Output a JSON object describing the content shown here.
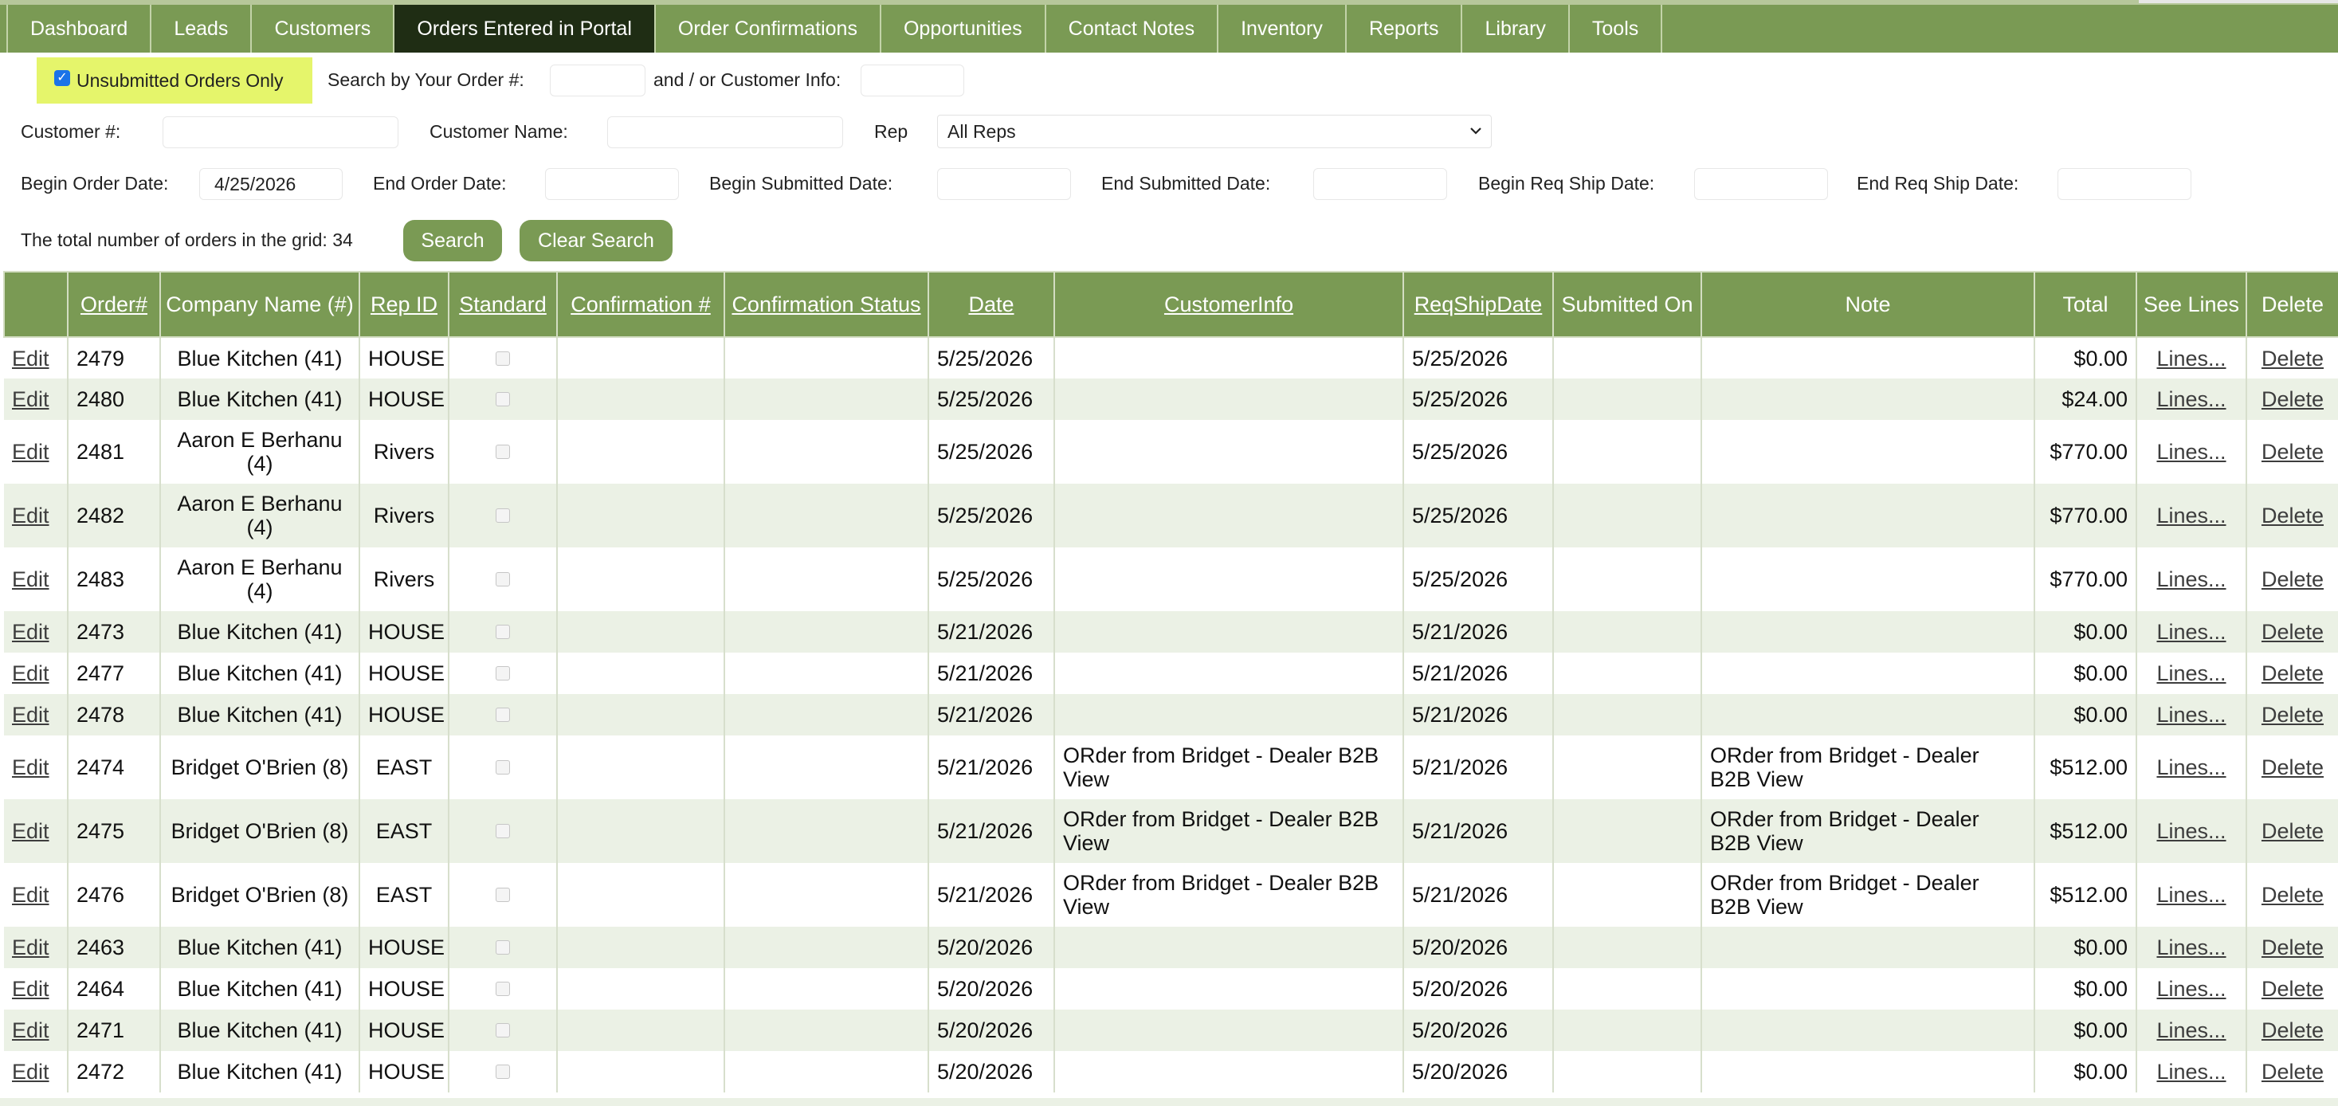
{
  "nav": {
    "tabs": [
      {
        "label": "Dashboard",
        "active": false
      },
      {
        "label": "Leads",
        "active": false
      },
      {
        "label": "Customers",
        "active": false
      },
      {
        "label": "Orders Entered in Portal",
        "active": true
      },
      {
        "label": "Order Confirmations",
        "active": false
      },
      {
        "label": "Opportunities",
        "active": false
      },
      {
        "label": "Contact Notes",
        "active": false
      },
      {
        "label": "Inventory",
        "active": false
      },
      {
        "label": "Reports",
        "active": false
      },
      {
        "label": "Library",
        "active": false
      },
      {
        "label": "Tools",
        "active": false
      }
    ]
  },
  "filters": {
    "unsubmitted_label": "Unsubmitted Orders Only",
    "unsubmitted_checked": true,
    "search_order_label": "Search by Your Order #:",
    "and_or_label": "and / or Customer Info:",
    "customer_num_label": "Customer #:",
    "customer_name_label": "Customer Name:",
    "rep_label": "Rep",
    "rep_value": "All Reps",
    "begin_order_date_label": "Begin Order Date:",
    "begin_order_date_value": "4/25/2026",
    "end_order_date_label": "End Order Date:",
    "begin_submitted_label": "Begin Submitted Date:",
    "end_submitted_label": "End Submitted Date:",
    "begin_req_ship_label": "Begin Req Ship Date:",
    "end_req_ship_label": "End Req Ship Date:",
    "total_label": "The total number of orders in the grid: 34",
    "search_button": "Search",
    "clear_button": "Clear Search"
  },
  "grid": {
    "headers": {
      "edit": "",
      "order": "Order#",
      "company": "Company Name (#)",
      "rep": "Rep ID",
      "standard": "Standard",
      "conf_num": "Confirmation #",
      "conf_status": "Confirmation Status",
      "date": "Date",
      "customer_info": "CustomerInfo",
      "req_ship": "ReqShipDate",
      "submitted": "Submitted On",
      "note": "Note",
      "total": "Total",
      "see_lines": "See Lines",
      "delete": "Delete"
    },
    "edit_text": "Edit",
    "lines_text": "Lines...",
    "delete_text": "Delete",
    "rows": [
      {
        "order": "2479",
        "company": "Blue Kitchen (41)",
        "rep": "HOUSE",
        "date": "5/25/2026",
        "customer_info": "",
        "req_ship": "5/25/2026",
        "submitted": "",
        "note": "",
        "total": "$0.00"
      },
      {
        "order": "2480",
        "company": "Blue Kitchen (41)",
        "rep": "HOUSE",
        "date": "5/25/2026",
        "customer_info": "",
        "req_ship": "5/25/2026",
        "submitted": "",
        "note": "",
        "total": "$24.00"
      },
      {
        "order": "2481",
        "company": "Aaron E Berhanu (4)",
        "rep": "Rivers",
        "date": "5/25/2026",
        "customer_info": "",
        "req_ship": "5/25/2026",
        "submitted": "",
        "note": "",
        "total": "$770.00"
      },
      {
        "order": "2482",
        "company": "Aaron E Berhanu (4)",
        "rep": "Rivers",
        "date": "5/25/2026",
        "customer_info": "",
        "req_ship": "5/25/2026",
        "submitted": "",
        "note": "",
        "total": "$770.00"
      },
      {
        "order": "2483",
        "company": "Aaron E Berhanu (4)",
        "rep": "Rivers",
        "date": "5/25/2026",
        "customer_info": "",
        "req_ship": "5/25/2026",
        "submitted": "",
        "note": "",
        "total": "$770.00"
      },
      {
        "order": "2473",
        "company": "Blue Kitchen (41)",
        "rep": "HOUSE",
        "date": "5/21/2026",
        "customer_info": "",
        "req_ship": "5/21/2026",
        "submitted": "",
        "note": "",
        "total": "$0.00"
      },
      {
        "order": "2477",
        "company": "Blue Kitchen (41)",
        "rep": "HOUSE",
        "date": "5/21/2026",
        "customer_info": "",
        "req_ship": "5/21/2026",
        "submitted": "",
        "note": "",
        "total": "$0.00"
      },
      {
        "order": "2478",
        "company": "Blue Kitchen (41)",
        "rep": "HOUSE",
        "date": "5/21/2026",
        "customer_info": "",
        "req_ship": "5/21/2026",
        "submitted": "",
        "note": "",
        "total": "$0.00"
      },
      {
        "order": "2474",
        "company": "Bridget O'Brien (8)",
        "rep": "EAST",
        "date": "5/21/2026",
        "customer_info": "ORder from Bridget - Dealer B2B View",
        "req_ship": "5/21/2026",
        "submitted": "",
        "note": "ORder from Bridget - Dealer B2B View",
        "total": "$512.00"
      },
      {
        "order": "2475",
        "company": "Bridget O'Brien (8)",
        "rep": "EAST",
        "date": "5/21/2026",
        "customer_info": "ORder from Bridget - Dealer B2B View",
        "req_ship": "5/21/2026",
        "submitted": "",
        "note": "ORder from Bridget - Dealer B2B View",
        "total": "$512.00"
      },
      {
        "order": "2476",
        "company": "Bridget O'Brien (8)",
        "rep": "EAST",
        "date": "5/21/2026",
        "customer_info": "ORder from Bridget - Dealer B2B View",
        "req_ship": "5/21/2026",
        "submitted": "",
        "note": "ORder from Bridget - Dealer B2B View",
        "total": "$512.00"
      },
      {
        "order": "2463",
        "company": "Blue Kitchen (41)",
        "rep": "HOUSE",
        "date": "5/20/2026",
        "customer_info": "",
        "req_ship": "5/20/2026",
        "submitted": "",
        "note": "",
        "total": "$0.00"
      },
      {
        "order": "2464",
        "company": "Blue Kitchen (41)",
        "rep": "HOUSE",
        "date": "5/20/2026",
        "customer_info": "",
        "req_ship": "5/20/2026",
        "submitted": "",
        "note": "",
        "total": "$0.00"
      },
      {
        "order": "2471",
        "company": "Blue Kitchen (41)",
        "rep": "HOUSE",
        "date": "5/20/2026",
        "customer_info": "",
        "req_ship": "5/20/2026",
        "submitted": "",
        "note": "",
        "total": "$0.00"
      },
      {
        "order": "2472",
        "company": "Blue Kitchen (41)",
        "rep": "HOUSE",
        "date": "5/20/2026",
        "customer_info": "",
        "req_ship": "5/20/2026",
        "submitted": "",
        "note": "",
        "total": "$0.00"
      }
    ]
  }
}
